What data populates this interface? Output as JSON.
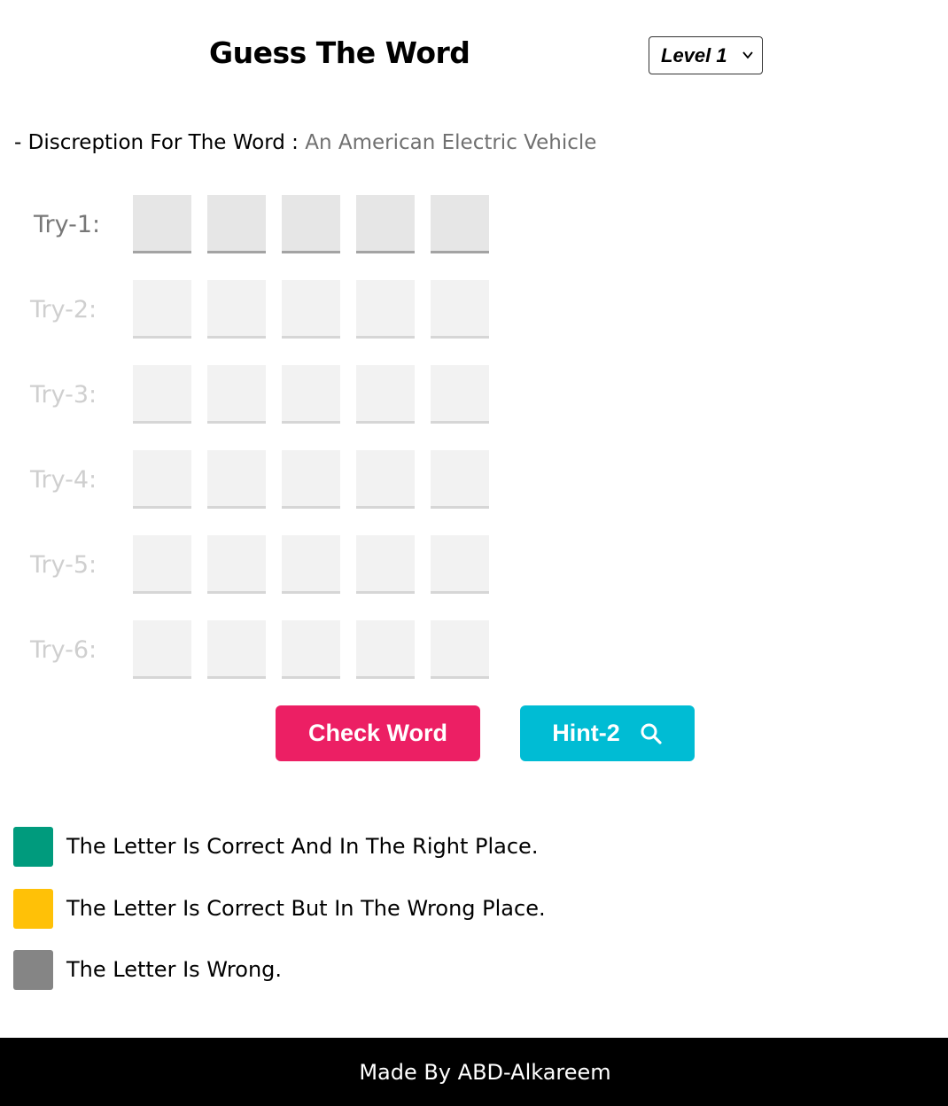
{
  "header": {
    "title": "Guess The Word",
    "level_selected": "Level 1"
  },
  "description": {
    "label": "- Discreption For The Word :",
    "value": "An American Electric Vehicle"
  },
  "tries": [
    {
      "label": "Try-1:",
      "active": true
    },
    {
      "label": "Try-2:",
      "active": false
    },
    {
      "label": "Try-3:",
      "active": false
    },
    {
      "label": "Try-4:",
      "active": false
    },
    {
      "label": "Try-5:",
      "active": false
    },
    {
      "label": "Try-6:",
      "active": false
    }
  ],
  "letters_per_try": 5,
  "buttons": {
    "check_label": "Check Word",
    "hint_label": "Hint-2"
  },
  "legend": [
    {
      "text": "The Letter Is Correct And In The Right Place.",
      "color": "#009b7d"
    },
    {
      "text": "The Letter Is Correct But In The Wrong Place.",
      "color": "#ffc107"
    },
    {
      "text": "The Letter Is Wrong.",
      "color": "#858585"
    }
  ],
  "colors": {
    "check_button": "#ec1f64",
    "hint_button": "#00bcd4",
    "footer_bg": "#000000"
  },
  "footer": {
    "text": "Made By ABD-Alkareem"
  }
}
